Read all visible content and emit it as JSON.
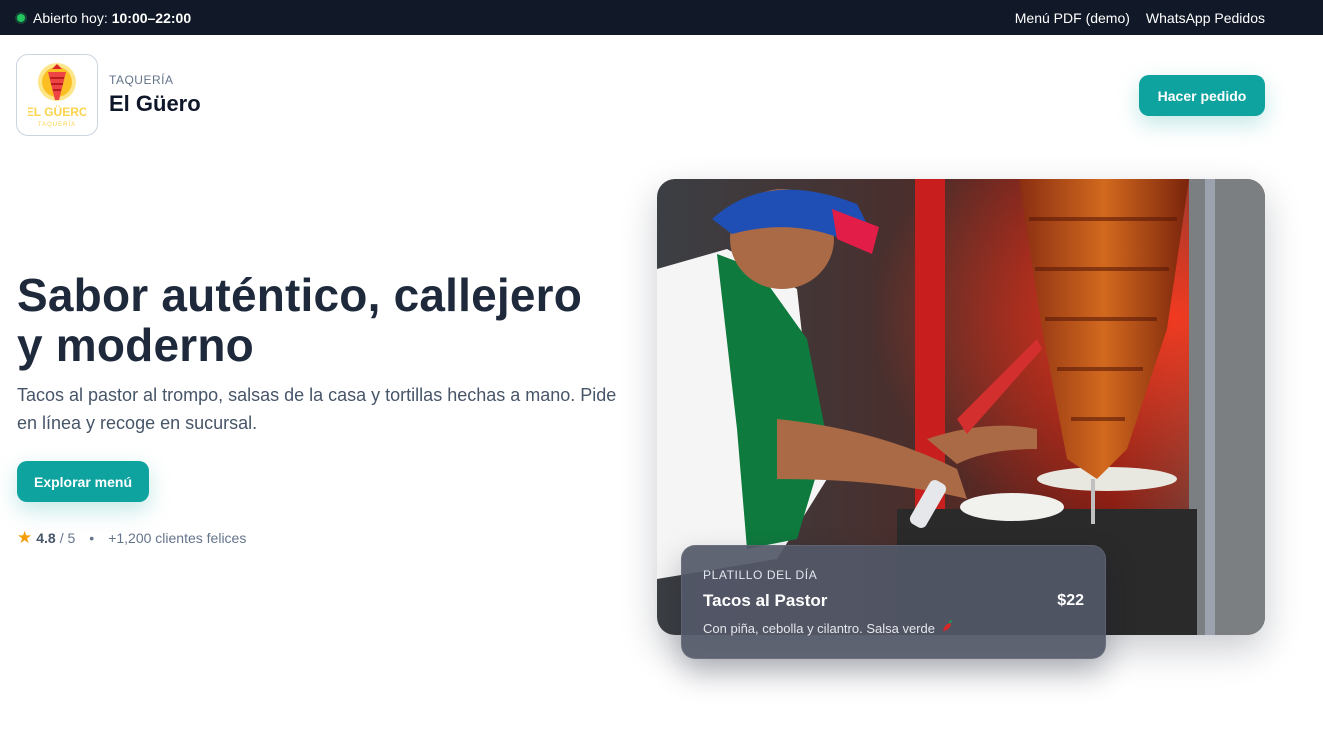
{
  "topbar": {
    "status_prefix": "Abierto hoy:",
    "hours": "10:00–22:00",
    "links": [
      "Menú PDF (demo)",
      "WhatsApp Pedidos"
    ]
  },
  "header": {
    "logo_text": "EL GÜERO",
    "logo_subtext": "TAQUERÍA",
    "brand_sub": "TAQUERÍA",
    "brand_name": "El Güero",
    "order_button": "Hacer pedido"
  },
  "hero": {
    "title_line1": "Sabor auténtico, callejero",
    "title_line2": "y moderno",
    "description": "Tacos al pastor al trompo, salsas de la casa y tortillas hechas a mano. Pide en línea y recoge en sucursal.",
    "explore_button": "Explorar menú",
    "rating_value": "4.8",
    "rating_max": "/ 5",
    "customers": "+1,200 clientes felices"
  },
  "dish_of_day": {
    "label": "PLATILLO DEL DÍA",
    "name": "Tacos al Pastor",
    "price": "$22",
    "description": "Con piña, cebolla y cilantro. Salsa verde"
  },
  "icons": {
    "status": "status-dot-icon",
    "star": "star-icon",
    "pepper": "chili-pepper-icon"
  },
  "colors": {
    "topbar": "#111827",
    "accent": "#0fa3a0",
    "status": "#22c55e",
    "star": "#f59e0b"
  }
}
